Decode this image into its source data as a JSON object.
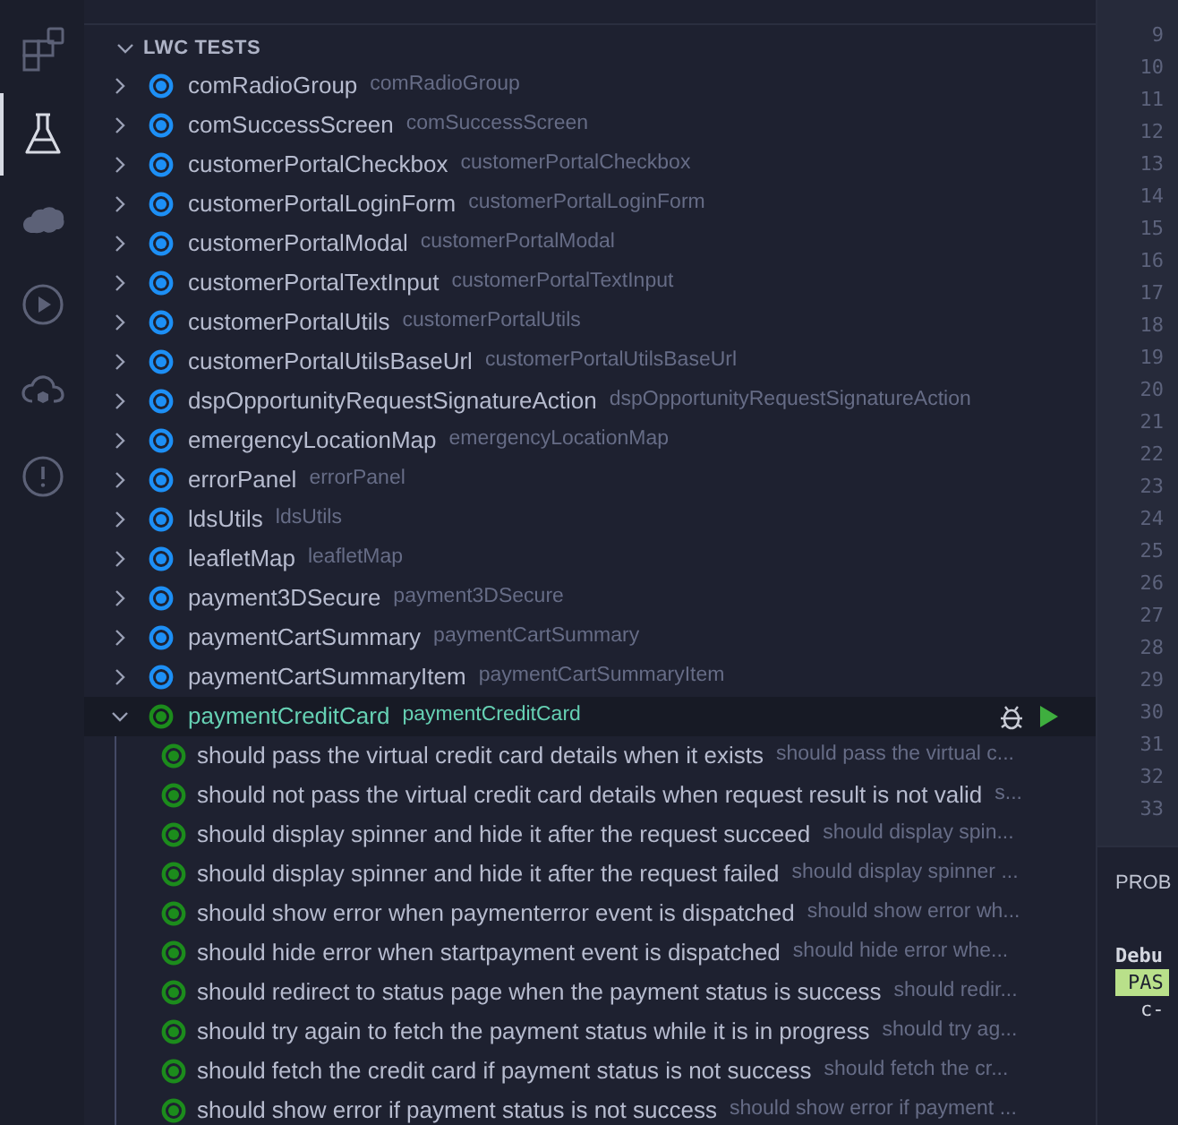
{
  "activity_bar": {
    "items": [
      {
        "kind": "extensions",
        "selected": false
      },
      {
        "kind": "testing",
        "selected": true
      },
      {
        "kind": "salesforce",
        "selected": false
      },
      {
        "kind": "run",
        "selected": false
      },
      {
        "kind": "cloud",
        "selected": false
      },
      {
        "kind": "problems",
        "selected": false
      }
    ]
  },
  "sidebar": {
    "section": {
      "title": "LWC TESTS",
      "expanded": true
    },
    "items": [
      {
        "label": "comRadioGroup",
        "description": "comRadioGroup",
        "kind": "idle",
        "expanded": false,
        "selected": false
      },
      {
        "label": "comSuccessScreen",
        "description": "comSuccessScreen",
        "kind": "idle",
        "expanded": false,
        "selected": false
      },
      {
        "label": "customerPortalCheckbox",
        "description": "customerPortalCheckbox",
        "kind": "idle",
        "expanded": false,
        "selected": false
      },
      {
        "label": "customerPortalLoginForm",
        "description": "customerPortalLoginForm",
        "kind": "idle",
        "expanded": false,
        "selected": false
      },
      {
        "label": "customerPortalModal",
        "description": "customerPortalModal",
        "kind": "idle",
        "expanded": false,
        "selected": false
      },
      {
        "label": "customerPortalTextInput",
        "description": "customerPortalTextInput",
        "kind": "idle",
        "expanded": false,
        "selected": false
      },
      {
        "label": "customerPortalUtils",
        "description": "customerPortalUtils",
        "kind": "idle",
        "expanded": false,
        "selected": false
      },
      {
        "label": "customerPortalUtilsBaseUrl",
        "description": "customerPortalUtilsBaseUrl",
        "kind": "idle",
        "expanded": false,
        "selected": false
      },
      {
        "label": "dspOpportunityRequestSignatureAction",
        "description": "dspOpportunityRequestSignatureAction",
        "kind": "idle",
        "expanded": false,
        "selected": false
      },
      {
        "label": "emergencyLocationMap",
        "description": "emergencyLocationMap",
        "kind": "idle",
        "expanded": false,
        "selected": false
      },
      {
        "label": "errorPanel",
        "description": "errorPanel",
        "kind": "idle",
        "expanded": false,
        "selected": false
      },
      {
        "label": "ldsUtils",
        "description": "ldsUtils",
        "kind": "idle",
        "expanded": false,
        "selected": false
      },
      {
        "label": "leafletMap",
        "description": "leafletMap",
        "kind": "idle",
        "expanded": false,
        "selected": false
      },
      {
        "label": "payment3DSecure",
        "description": "payment3DSecure",
        "kind": "idle",
        "expanded": false,
        "selected": false
      },
      {
        "label": "paymentCartSummary",
        "description": "paymentCartSummary",
        "kind": "idle",
        "expanded": false,
        "selected": false
      },
      {
        "label": "paymentCartSummaryItem",
        "description": "paymentCartSummaryItem",
        "kind": "idle",
        "expanded": false,
        "selected": false
      },
      {
        "label": "paymentCreditCard",
        "description": "paymentCreditCard",
        "kind": "passed",
        "expanded": true,
        "selected": true,
        "children": [
          {
            "label": "should pass the virtual credit card details when it exists",
            "description": "should pass the virtual c...",
            "kind": "passed"
          },
          {
            "label": "should not pass the virtual credit card details when request result is not valid",
            "description": "s...",
            "kind": "passed"
          },
          {
            "label": "should display spinner and hide it after the request succeed",
            "description": "should display spin...",
            "kind": "passed"
          },
          {
            "label": "should display spinner and hide it after the request failed",
            "description": "should display spinner ...",
            "kind": "passed"
          },
          {
            "label": "should show error when paymenterror event is dispatched",
            "description": "should show error wh...",
            "kind": "passed"
          },
          {
            "label": "should hide error when startpayment event is dispatched",
            "description": "should hide error whe...",
            "kind": "passed"
          },
          {
            "label": "should redirect to status page when the payment status is success",
            "description": "should redir...",
            "kind": "passed"
          },
          {
            "label": "should try again to fetch the payment status while it is in progress",
            "description": "should try ag...",
            "kind": "passed"
          },
          {
            "label": "should fetch the credit card if payment status is not success",
            "description": "should fetch the cr...",
            "kind": "passed"
          },
          {
            "label": "should show error if payment status is not success",
            "description": "should show error if payment ...",
            "kind": "passed"
          }
        ]
      }
    ]
  },
  "editor": {
    "line_numbers": [
      "9",
      "10",
      "11",
      "12",
      "13",
      "14",
      "15",
      "16",
      "17",
      "18",
      "19",
      "20",
      "21",
      "22",
      "23",
      "24",
      "25",
      "26",
      "27",
      "28",
      "29",
      "30",
      "31",
      "32",
      "33"
    ]
  },
  "panel": {
    "tab": "PROB",
    "output": [
      {
        "kind": "heading",
        "text": "Debu"
      },
      {
        "kind": "badge",
        "text": "PAS"
      },
      {
        "kind": "text",
        "text": "c-"
      }
    ]
  }
}
